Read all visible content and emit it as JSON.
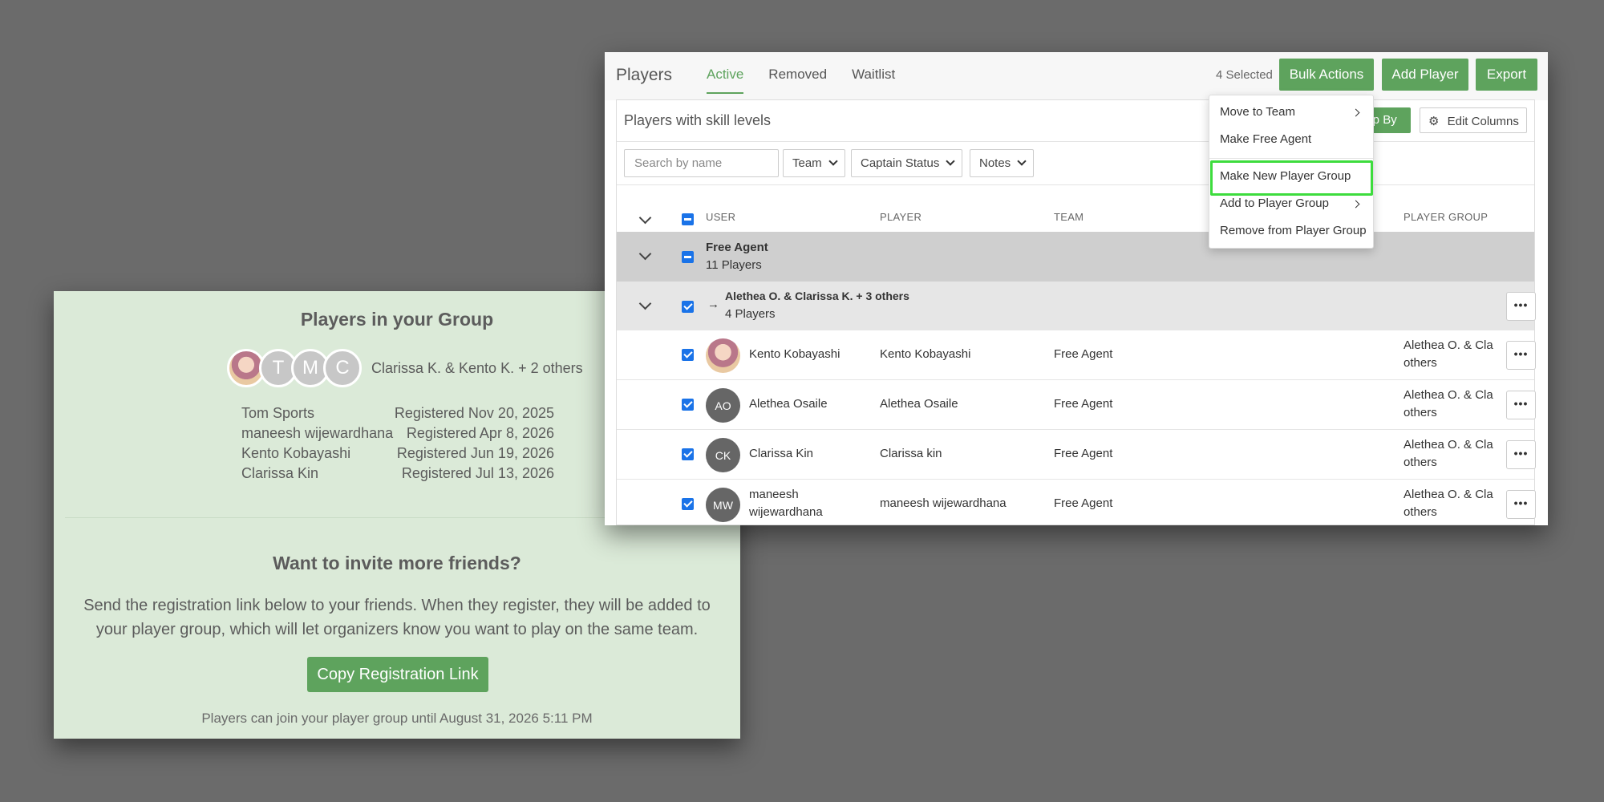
{
  "group_card": {
    "title": "Players in your Group",
    "avatars": [
      {
        "initial": "",
        "icon": "photo-avatar"
      },
      {
        "initial": "T"
      },
      {
        "initial": "M"
      },
      {
        "initial": "C"
      }
    ],
    "summary": "Clarissa K. & Kento K. + 2 others",
    "registrations": [
      {
        "name": "Tom Sports",
        "date": "Registered Nov 20, 2025"
      },
      {
        "name": "maneesh wijewardhana",
        "date": "Registered Apr 8, 2026"
      },
      {
        "name": "Kento Kobayashi",
        "date": "Registered Jun 19, 2026"
      },
      {
        "name": "Clarissa Kin",
        "date": "Registered Jul 13, 2026"
      }
    ],
    "invite_title": "Want to invite more friends?",
    "invite_body": "Send the registration link below to your friends. When they register, they will be added to your player group, which will let organizers know you want to play on the same team.",
    "copy_button": "Copy Registration Link",
    "join_note": "Players can join your player group until August 31, 2026 5:11 PM"
  },
  "admin": {
    "title": "Players",
    "tabs": [
      "Active",
      "Removed",
      "Waitlist"
    ],
    "active_tab": "Active",
    "selected_count": "4 Selected",
    "bulk_actions": "Bulk Actions",
    "add_player": "Add Player",
    "export": "Export",
    "panel_title": "Players with skill levels",
    "group_by": "Group By",
    "group_by_visible": "oup By",
    "edit_columns": "Edit Columns",
    "search_placeholder": "Search by name",
    "filters": [
      "Team",
      "Captain Status",
      "Notes"
    ],
    "columns": {
      "user": "USER",
      "player": "PLAYER",
      "team": "TEAM",
      "player_group": "PLAYER GROUP"
    },
    "free_agent_group": {
      "title": "Free Agent",
      "count": "11 Players"
    },
    "sub_group": {
      "title": "Alethea O. & Clarissa K. + 3 others",
      "count": "4 Players"
    },
    "rows": [
      {
        "initials": "",
        "photo": true,
        "user": "Kento Kobayashi",
        "player": "Kento Kobayashi",
        "team": "Free Agent",
        "group_line1": "Alethea O. & Cla",
        "group_line2": "others"
      },
      {
        "initials": "AO",
        "user": "Alethea Osaile",
        "player": "Alethea Osaile",
        "team": "Free Agent",
        "group_line1": "Alethea O. & Cla",
        "group_line2": "others"
      },
      {
        "initials": "CK",
        "user": "Clarissa Kin",
        "player": "Clarissa kin",
        "team": "Free Agent",
        "group_line1": "Alethea O. & Cla",
        "group_line2": "others"
      },
      {
        "initials": "MW",
        "user_line1": "maneesh",
        "user_line2": "wijewardhana",
        "player": "maneesh wijewardhana",
        "team": "Free Agent",
        "group_line1": "Alethea O. & Cla",
        "group_line2": "others"
      }
    ],
    "menu": {
      "items": [
        "Move to Team",
        "Make Free Agent",
        "Make New Player Group",
        "Add to Player Group",
        "Remove from Player Group"
      ],
      "highlighted": "Make New Player Group",
      "highlight_color": "#3ddc3d"
    },
    "more_icon": "ellipsis-icon"
  },
  "colors": {
    "background": "#6b6b6b",
    "card": "#dbead8",
    "accent": "#5ea35d",
    "checkbox": "#1a73e8"
  }
}
